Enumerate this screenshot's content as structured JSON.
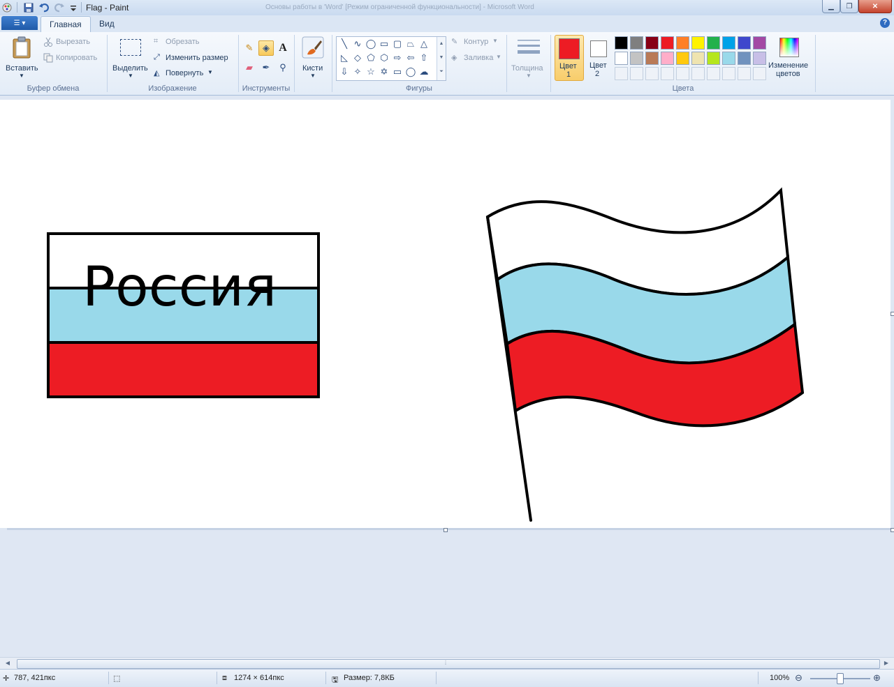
{
  "window": {
    "title": "Flag - Paint",
    "background_title": "Основы работы в 'Word' [Режим ограниченной функциональности] - Microsoft Word"
  },
  "tabs": [
    {
      "label": "Главная",
      "active": true
    },
    {
      "label": "Вид",
      "active": false
    }
  ],
  "ribbon": {
    "clipboard": {
      "paste": "Вставить",
      "cut": "Вырезать",
      "copy": "Копировать",
      "group": "Буфер обмена"
    },
    "image": {
      "select": "Выделить",
      "crop": "Обрезать",
      "resize": "Изменить размер",
      "rotate": "Повернуть",
      "group": "Изображение"
    },
    "tools": {
      "group": "Инструменты",
      "selected": "fill"
    },
    "brushes": {
      "label": "Кисти"
    },
    "shapes": {
      "outline": "Контур",
      "fill": "Заливка",
      "group": "Фигуры"
    },
    "size": {
      "label": "Толщина"
    },
    "colors": {
      "color1_line1": "Цвет",
      "color1_line2": "1",
      "color2_line1": "Цвет",
      "color2_line2": "2",
      "edit_line1": "Изменение",
      "edit_line2": "цветов",
      "group": "Цвета",
      "color1": "#ed1c24",
      "color2": "#ffffff",
      "palette_row1": [
        "#000000",
        "#7f7f7f",
        "#880015",
        "#ed1c24",
        "#ff7f27",
        "#fff200",
        "#22b14c",
        "#00a2e8",
        "#3f48cc",
        "#a349a4"
      ],
      "palette_row2": [
        "#ffffff",
        "#c3c3c3",
        "#b97a57",
        "#ffaec9",
        "#ffc90e",
        "#efe4b0",
        "#b5e61d",
        "#99d9ea",
        "#7092be",
        "#c8bfe7"
      ]
    }
  },
  "canvas": {
    "text": "Россия",
    "flag_colors": {
      "white": "#ffffff",
      "blue": "#99d9ea",
      "red": "#ed1c24"
    }
  },
  "status": {
    "cursor": "787, 421пкс",
    "size": "1274 × 614пкс",
    "filesize": "Размер: 7,8КБ",
    "zoom": "100%",
    "zoom_level": 0.5
  }
}
